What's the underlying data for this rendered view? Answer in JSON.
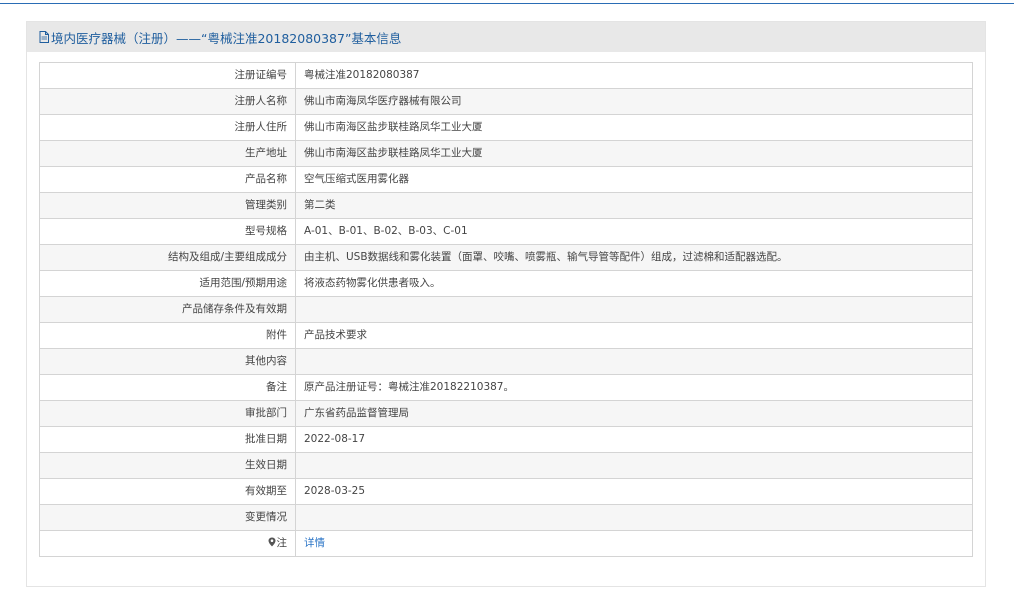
{
  "header": {
    "title": "境内医疗器械（注册）——“粤械注准20182080387”基本信息",
    "icon": "document-icon"
  },
  "rows": [
    {
      "label": "注册证编号",
      "value": "粤械注准20182080387"
    },
    {
      "label": "注册人名称",
      "value": "佛山市南海凤华医疗器械有限公司"
    },
    {
      "label": "注册人住所",
      "value": "佛山市南海区盐步联桂路凤华工业大厦"
    },
    {
      "label": "生产地址",
      "value": "佛山市南海区盐步联桂路凤华工业大厦"
    },
    {
      "label": "产品名称",
      "value": "空气压缩式医用雾化器"
    },
    {
      "label": "管理类别",
      "value": "第二类"
    },
    {
      "label": "型号规格",
      "value": "A-01、B-01、B-02、B-03、C-01"
    },
    {
      "label": "结构及组成/主要组成成分",
      "value": "由主机、USB数据线和雾化装置（面罩、咬嘴、喷雾瓶、输气导管等配件）组成，过滤棉和适配器选配。"
    },
    {
      "label": "适用范围/预期用途",
      "value": "将液态药物雾化供患者吸入。"
    },
    {
      "label": "产品储存条件及有效期",
      "value": ""
    },
    {
      "label": "附件",
      "value": "产品技术要求"
    },
    {
      "label": "其他内容",
      "value": ""
    },
    {
      "label": "备注",
      "value": "原产品注册证号：粤械注准20182210387。"
    },
    {
      "label": "审批部门",
      "value": "广东省药品监督管理局"
    },
    {
      "label": "批准日期",
      "value": "2022-08-17"
    },
    {
      "label": "生效日期",
      "value": ""
    },
    {
      "label": "有效期至",
      "value": "2028-03-25"
    },
    {
      "label": "变更情况",
      "value": ""
    }
  ],
  "note_row": {
    "label": "注",
    "icon": "pin-icon",
    "link_text": "详情"
  },
  "colors": {
    "accent": "#1f5e9e",
    "link": "#2a74c6",
    "header_bg": "#e8e8e8",
    "row_alt_bg": "#f6f6f6",
    "border": "#d4d4d4"
  }
}
